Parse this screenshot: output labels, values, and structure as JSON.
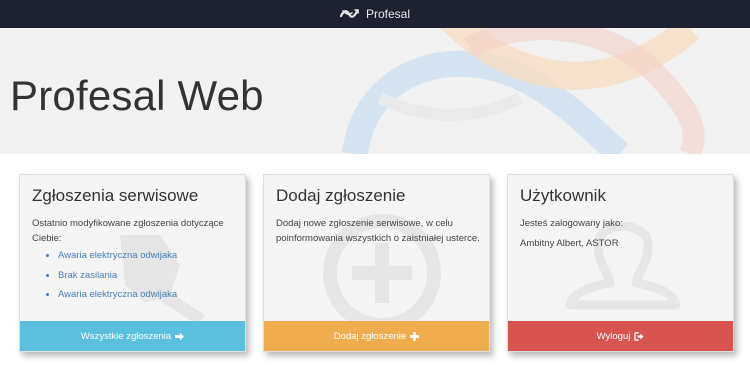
{
  "navbar": {
    "brand_icon": "profesal-logo-icon",
    "brand_name": "Profesal"
  },
  "hero": {
    "title": "Profesal Web"
  },
  "panels": {
    "tickets": {
      "title": "Zgłoszenia serwisowe",
      "description": "Ostatnio modyfikowane zgłoszenia dotyczące Ciebie:",
      "items": [
        {
          "label": "Awaria elektryczna odwijaka"
        },
        {
          "label": "Brak zasilania"
        },
        {
          "label": "Awaria elektryczna odwijaka"
        }
      ],
      "button_label": "Wszystkie zgłoszenia",
      "button_icon": "arrow-right-icon",
      "button_color": "#5bc0de"
    },
    "add_ticket": {
      "title": "Dodaj zgłoszenie",
      "description": "Dodaj nowe zgłoszenie serwisowe, w celu poinformowania wszystkich o zaistniałej usterce.",
      "button_label": "Dodaj zgłoszenie",
      "button_icon": "plus-icon",
      "button_color": "#f0ad4e"
    },
    "user": {
      "title": "Użytkownik",
      "description": "Jesteś zalogowany jako:",
      "user_name": "Ambitny Albert, ASTOR",
      "button_label": "Wyloguj",
      "button_icon": "sign-out-icon",
      "button_color": "#d9534f"
    }
  }
}
